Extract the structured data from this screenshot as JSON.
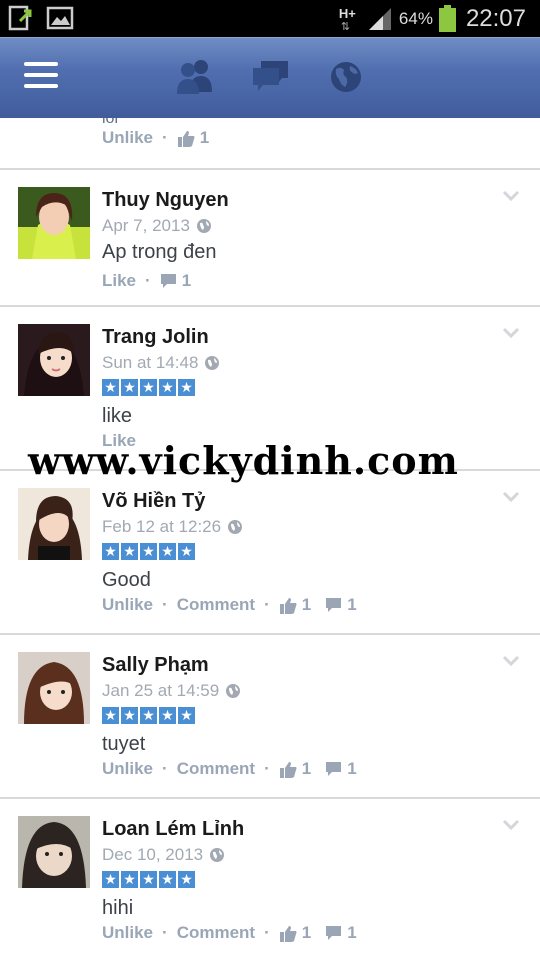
{
  "status_bar": {
    "icons_left": [
      "upload-notification-icon",
      "gallery-notification-icon"
    ],
    "network": "H+",
    "battery_percent": "64%",
    "battery_level": 0.64,
    "time": "22:07"
  },
  "header": {
    "icons": [
      "menu-icon",
      "friends-icon",
      "messages-icon",
      "globe-icon"
    ]
  },
  "partial_item": {
    "ghost_text": "lol",
    "like_action": "Unlike",
    "like_count": "1"
  },
  "reviews": [
    {
      "name": "Thuy Nguyen",
      "date": "Apr 7, 2013",
      "rating": 0,
      "comment": "Ap trong đen",
      "actions": [
        "Like"
      ],
      "comment_count": "1"
    },
    {
      "name": "Trang Jolin",
      "date": "Sun at 14:48",
      "rating": 5,
      "comment": "like",
      "actions": [
        "Like"
      ]
    },
    {
      "name": "Võ Hiền Tỷ",
      "date": "Feb 12 at 12:26",
      "rating": 5,
      "comment": "Good",
      "actions": [
        "Unlike",
        "Comment"
      ],
      "like_count": "1",
      "comment_count": "1"
    },
    {
      "name": "Sally Phạm",
      "date": "Jan 25 at 14:59",
      "rating": 5,
      "comment": "tuyet",
      "actions": [
        "Unlike",
        "Comment"
      ],
      "like_count": "1",
      "comment_count": "1"
    },
    {
      "name": "Loan Lém Lỉnh",
      "date": "Dec 10, 2013",
      "rating": 5,
      "comment": "hihi",
      "actions": [
        "Unlike",
        "Comment"
      ],
      "like_count": "1",
      "comment_count": "1"
    }
  ],
  "watermark": "www.vickydinh.com",
  "colors": {
    "header_blue": "#516fb0",
    "star_blue": "#4a8fd3",
    "action_gray": "#9aa6b6",
    "divider": "#d7d9dd",
    "battery_green": "#8dc63f"
  }
}
